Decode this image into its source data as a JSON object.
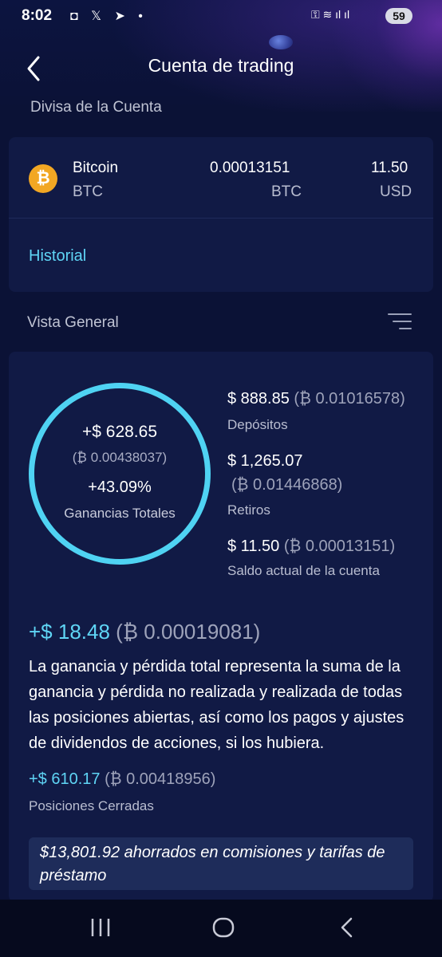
{
  "status_bar": {
    "time": "8:02",
    "left_icons": "◘ 𝕏 ➤ •",
    "right_icons": "⚿ ≋ ıl ıl",
    "battery": "59"
  },
  "nav": {
    "title": "Cuenta de trading",
    "back_icon": "chevron-left"
  },
  "account_currency": {
    "label": "Divisa de la Cuenta",
    "coin_name": "Bitcoin",
    "coin_symbol": "BTC",
    "coin_icon": "₿",
    "balance": "0.00013151",
    "balance_unit": "BTC",
    "fiat_value": "11.50",
    "fiat_unit": "USD",
    "history_link": "Historial"
  },
  "overview": {
    "label": "Vista General",
    "ring_color": "#4fd3f3",
    "total_usd": "+$ 628.65",
    "total_btc": "(₿ 0.00438037)",
    "total_pct": "+43.09%",
    "total_label": "Ganancias Totales",
    "deposits_usd": "$ 888.85",
    "deposits_btc": "(₿ 0.01016578)",
    "deposits_label": "Depósitos",
    "withdrawals_usd": "$ 1,265.07",
    "withdrawals_btc": "(₿ 0.01446868)",
    "withdrawals_label": "Retiros",
    "balance_usd": "$ 11.50",
    "balance_btc": "(₿ 0.00013151)",
    "balance_label": "Saldo actual de la cuenta"
  },
  "pnl": {
    "usd": "+$ 18.48",
    "btc": "(₿ 0.00019081)",
    "description": "La ganancia y pérdida total representa la suma de la ganancia y pérdida no realizada y realizada de todas las posiciones abiertas, así como los pagos y ajustes de dividendos de acciones, si los hubiera.",
    "closed_usd": "+$ 610.17",
    "closed_btc": "(₿ 0.00418956)",
    "closed_label": "Posiciones Cerradas",
    "savings": "$13,801.92 ahorrados en comisiones y tarifas de préstamo"
  },
  "colors": {
    "background": "#0b1236",
    "card": "#111a45",
    "accent": "#5fd5f5"
  }
}
